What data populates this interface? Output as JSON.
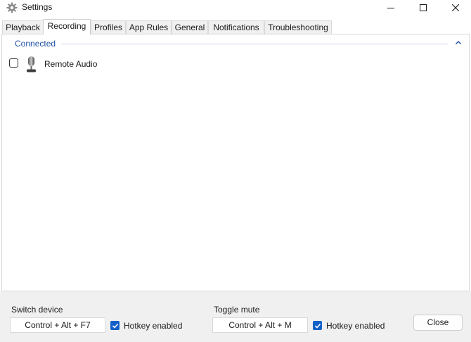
{
  "window": {
    "title": "Settings"
  },
  "tabs": [
    {
      "label": "Playback"
    },
    {
      "label": "Recording"
    },
    {
      "label": "Profiles"
    },
    {
      "label": "App Rules"
    },
    {
      "label": "General"
    },
    {
      "label": "Notifications"
    },
    {
      "label": "Troubleshooting"
    }
  ],
  "active_tab": "Recording",
  "groups": [
    {
      "label": "Connected",
      "devices": [
        {
          "name": "Remote Audio",
          "checked": false,
          "icon": "microphone-icon"
        }
      ]
    }
  ],
  "hotkeys": {
    "switch_device": {
      "title": "Switch device",
      "keys": "Control + Alt + F7",
      "enabled_label": "Hotkey enabled",
      "enabled": true
    },
    "toggle_mute": {
      "title": "Toggle mute",
      "keys": "Control + Alt + M",
      "enabled_label": "Hotkey enabled",
      "enabled": true
    }
  },
  "close_label": "Close",
  "colors": {
    "accent": "#1260c8",
    "group_label": "#1e4fa3"
  }
}
